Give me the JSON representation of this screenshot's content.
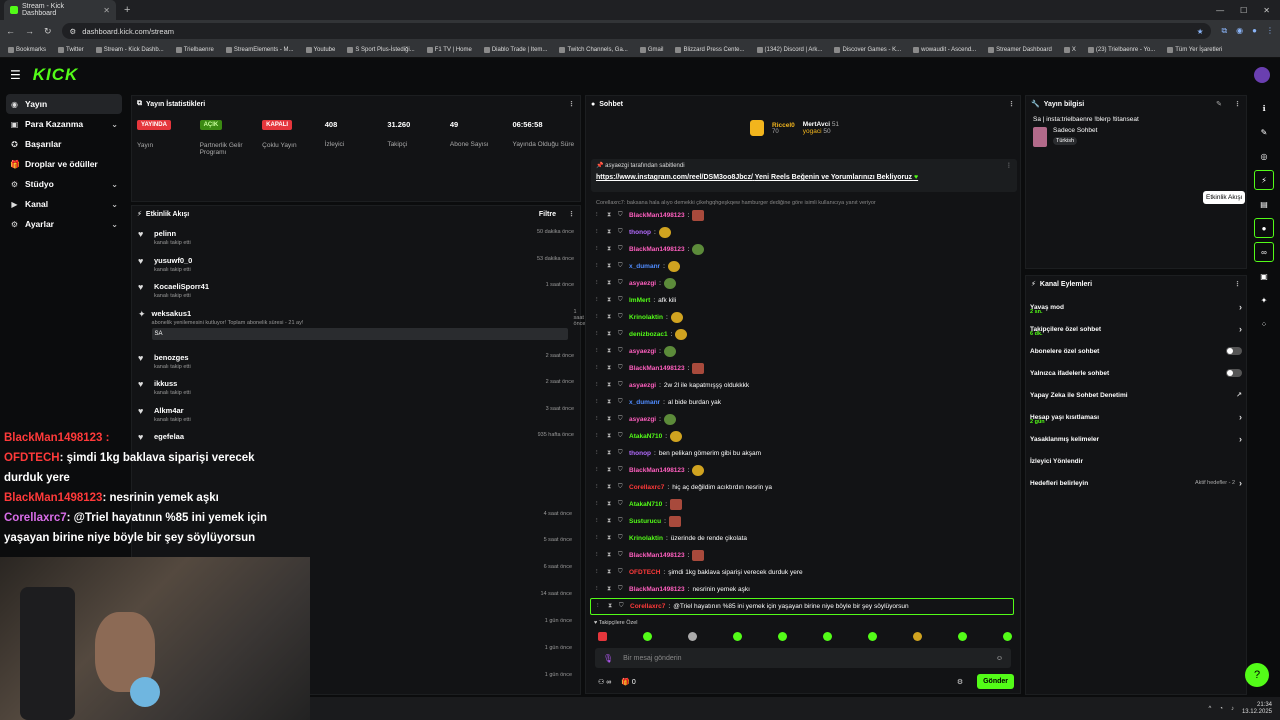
{
  "browser": {
    "tab_title": "Stream - Kick Dashboard",
    "url": "dashboard.kick.com/stream",
    "bookmarks": [
      "Bookmarks",
      "Twitter",
      "Stream - Kick Dashb...",
      "Trielbaenre",
      "StreamElements - M...",
      "Youtube",
      "S Sport Plus-İstediği...",
      "F1 TV | Home",
      "Diablo Trade | Item...",
      "Twitch Channels, Ga...",
      "Gmail",
      "Blizzard Press Cente...",
      "(1342) Discord | Ark...",
      "Discover Games - K...",
      "wowaudit - Ascend...",
      "Streamer Dashboard",
      "X",
      "(23) Trielbaenre - Yo...",
      "Tüm Yer İşaretleri"
    ]
  },
  "app": {
    "logo": "KICK",
    "accent": "#53fc18"
  },
  "sidebar": {
    "items": [
      {
        "label": "Yayın",
        "icon": "broadcast-icon"
      },
      {
        "label": "Para Kazanma",
        "icon": "money-icon"
      },
      {
        "label": "Başarılar",
        "icon": "trophy-icon"
      },
      {
        "label": "Droplar ve ödüller",
        "icon": "gift-icon"
      },
      {
        "label": "Stüdyo",
        "icon": "studio-icon"
      },
      {
        "label": "Kanal",
        "icon": "channel-icon"
      },
      {
        "label": "Ayarlar",
        "icon": "settings-icon"
      }
    ]
  },
  "stats": {
    "title": "Yayın İstatistikleri",
    "cells": [
      {
        "badge": "YAYINDA",
        "label": "Yayın"
      },
      {
        "badge": "AÇIK",
        "label": "Partnerlik Gelir Programı"
      },
      {
        "badge": "KAPALI",
        "label": "Çoklu Yayın"
      },
      {
        "value": "408",
        "label": "İzleyici"
      },
      {
        "value": "31.260",
        "label": "Takipçi"
      },
      {
        "value": "49",
        "label": "Abone Sayısı"
      },
      {
        "value": "06:56:58",
        "label": "Yayında Olduğu Süre"
      }
    ]
  },
  "feed": {
    "title": "Etkinlik Akışı",
    "filter": "Filtre",
    "items": [
      {
        "name": "pelinn",
        "sub": "kanalı takip etti",
        "time": "50 dakika önce"
      },
      {
        "name": "yusuwf0_0",
        "sub": "kanalı takip etti",
        "time": "53 dakika önce"
      },
      {
        "name": "KocaeliSporr41",
        "sub": "kanalı takip etti",
        "time": "1 saat önce"
      },
      {
        "name": "weksakus1",
        "sub": "abonelik yenilemesini kutluyor! Toplam abonelik süresi - 21 ay!",
        "time": "1 saat önce",
        "msg": "SA"
      },
      {
        "name": "benozges",
        "sub": "kanalı takip etti",
        "time": "2 saat önce"
      },
      {
        "name": "ikkuss",
        "sub": "kanalı takip etti",
        "time": "2 saat önce"
      },
      {
        "name": "Alkm4ar",
        "sub": "kanalı takip etti",
        "time": "3 saat önce"
      },
      {
        "name": "egefelaa",
        "sub": "",
        "time": "935 hafta önce"
      }
    ],
    "more_times": [
      "4 saat önce",
      "5 saat önce",
      "6 saat önce",
      "14 saat önce",
      "1 gün önce",
      "1 gün önce",
      "1 gün önce"
    ]
  },
  "chat": {
    "title": "Sohbet",
    "top": [
      {
        "name": "Riccel0",
        "amount": "70"
      },
      {
        "name": "MertAvci",
        "amount": "51"
      },
      {
        "name": "yogaci",
        "amount": "50"
      }
    ],
    "pinned_by": "asyaezgi tarafından sabitlendi",
    "pinned_link": "https://www.instagram.com/reel/DSM3oo8Jbcz/",
    "pinned_text": "Yeni Reels Beğenin ve Yorumlarınızı Bekliyoruz",
    "reply_note": "Corellaxrc7: baksana hala alıyo demekki çikehgqhgeşkqew hamburger dediğine göre isimli kullanıcıya yanıt veriyor",
    "messages": [
      {
        "user": "BlackMan1498123",
        "color": "#ff5fbf",
        "text": "",
        "emote": "r"
      },
      {
        "user": "thonop",
        "color": "#b46bff",
        "text": "",
        "emote": "y"
      },
      {
        "user": "BlackMan1498123",
        "color": "#ff5fbf",
        "text": "",
        "emote": "g"
      },
      {
        "user": "x_dumanr",
        "color": "#4f8cff",
        "text": "",
        "emote": "y"
      },
      {
        "user": "asyaezgi",
        "color": "#ff5fbf",
        "text": "",
        "emote": "g"
      },
      {
        "user": "ImMert",
        "color": "#53fc18",
        "text": "afk kili",
        "emote": ""
      },
      {
        "user": "Krinolaktin",
        "color": "#53fc18",
        "text": "",
        "emote": "y"
      },
      {
        "user": "denizbozac1",
        "color": "#53fc18",
        "text": "",
        "emote": "y"
      },
      {
        "user": "asyaezgi",
        "color": "#ff5fbf",
        "text": "",
        "emote": "g"
      },
      {
        "user": "BlackMan1498123",
        "color": "#ff5fbf",
        "text": "",
        "emote": "r"
      },
      {
        "user": "asyaezgi",
        "color": "#ff5fbf",
        "text": "2w 2l ile kapatmışşş oldukkkk",
        "emote": ""
      },
      {
        "user": "x_dumanr",
        "color": "#4f8cff",
        "text": "al bide burdan yak",
        "emote": ""
      },
      {
        "user": "asyaezgi",
        "color": "#ff5fbf",
        "text": "",
        "emote": "g"
      },
      {
        "user": "AtakaN710",
        "color": "#53fc18",
        "text": "",
        "emote": "y"
      },
      {
        "user": "thonop",
        "color": "#b46bff",
        "text": "ben pelikan gömerim gibi bu akşam",
        "emote": ""
      },
      {
        "user": "BlackMan1498123",
        "color": "#ff5fbf",
        "text": "",
        "emote": "y"
      },
      {
        "user": "Corellaxrc7",
        "color": "#ff3a3a",
        "text": "hiç aç değildim acıktırdın nesrin ya",
        "emote": ""
      },
      {
        "user": "AtakaN710",
        "color": "#53fc18",
        "text": "",
        "emote": "r"
      },
      {
        "user": "Susturucu",
        "color": "#53fc18",
        "text": "",
        "emote": "r"
      },
      {
        "user": "Krinolaktin",
        "color": "#53fc18",
        "text": "üzerinde de rende çikolata",
        "emote": ""
      },
      {
        "user": "BlackMan1498123",
        "color": "#ff5fbf",
        "text": "",
        "emote": "r"
      },
      {
        "user": "OFDTECH",
        "color": "#ff3a3a",
        "text": "şimdi 1kg baklava siparişi verecek durduk yere",
        "emote": ""
      },
      {
        "user": "BlackMan1498123",
        "color": "#ff5fbf",
        "text": "nesrinin yemek aşkı",
        "emote": ""
      },
      {
        "user": "Corellaxrc7",
        "color": "#ff3a3a",
        "text": "@Triel hayatının %85 ini yemek için yaşayan birine niye böyle bir şey söylüyorsun",
        "emote": "",
        "highlight": true
      }
    ],
    "followers_only": "Takipçilere Özel",
    "input_placeholder": "Bir mesaj gönderin",
    "viewers_icon_count": "0",
    "send": "Gönder"
  },
  "info": {
    "title": "Yayın bilgisi",
    "stream_title": "Sa | insta:trielbaenre !blerp !titanseat",
    "category": "Sadece Sohbet",
    "tag": "Türkish"
  },
  "actions": {
    "title": "Kanal Eylemleri",
    "items": [
      {
        "label": "Yavaş mod",
        "sub": "2 sn.",
        "kind": "arrow"
      },
      {
        "label": "Takipçilere özel sohbet",
        "sub": "6 dk.",
        "kind": "arrow"
      },
      {
        "label": "Abonelere özel sohbet",
        "sub": "",
        "kind": "toggle"
      },
      {
        "label": "Yalnızca ifadelerle sohbet",
        "sub": "",
        "kind": "toggle"
      },
      {
        "label": "Yapay Zeka ile Sohbet Denetimi",
        "sub": "",
        "kind": "ext"
      },
      {
        "label": "Hesap yaşı kısıtlaması",
        "sub": "2 gün",
        "kind": "arrow"
      },
      {
        "label": "Yasaklanmış kelimeler",
        "sub": "",
        "kind": "arrow"
      },
      {
        "label": "İzleyici Yönlendir",
        "sub": "",
        "kind": "none"
      },
      {
        "label": "Hedefleri belirleyin",
        "sub": "",
        "kind": "arrow",
        "note": "Aktif hedefler - 2"
      }
    ]
  },
  "tooltip": "Etkinlik Akışı",
  "overlay": {
    "lines": [
      {
        "user": "BlackMan1498123 :",
        "text": ""
      },
      {
        "user": "OFDTECH",
        "text": ": şimdi 1kg baklava siparişi verecek"
      },
      {
        "user": "",
        "text": "durduk yere"
      },
      {
        "user": "BlackMan1498123",
        "text": ": nesrinin yemek aşkı"
      },
      {
        "user": "Corellaxrc7",
        "text": ": @Triel hayatının %85 ini yemek için"
      },
      {
        "user": "",
        "text": "yaşayan birine niye böyle bir şey söylüyorsun"
      }
    ]
  },
  "taskbar": {
    "time": "21:34",
    "date": "13.12.2025"
  }
}
